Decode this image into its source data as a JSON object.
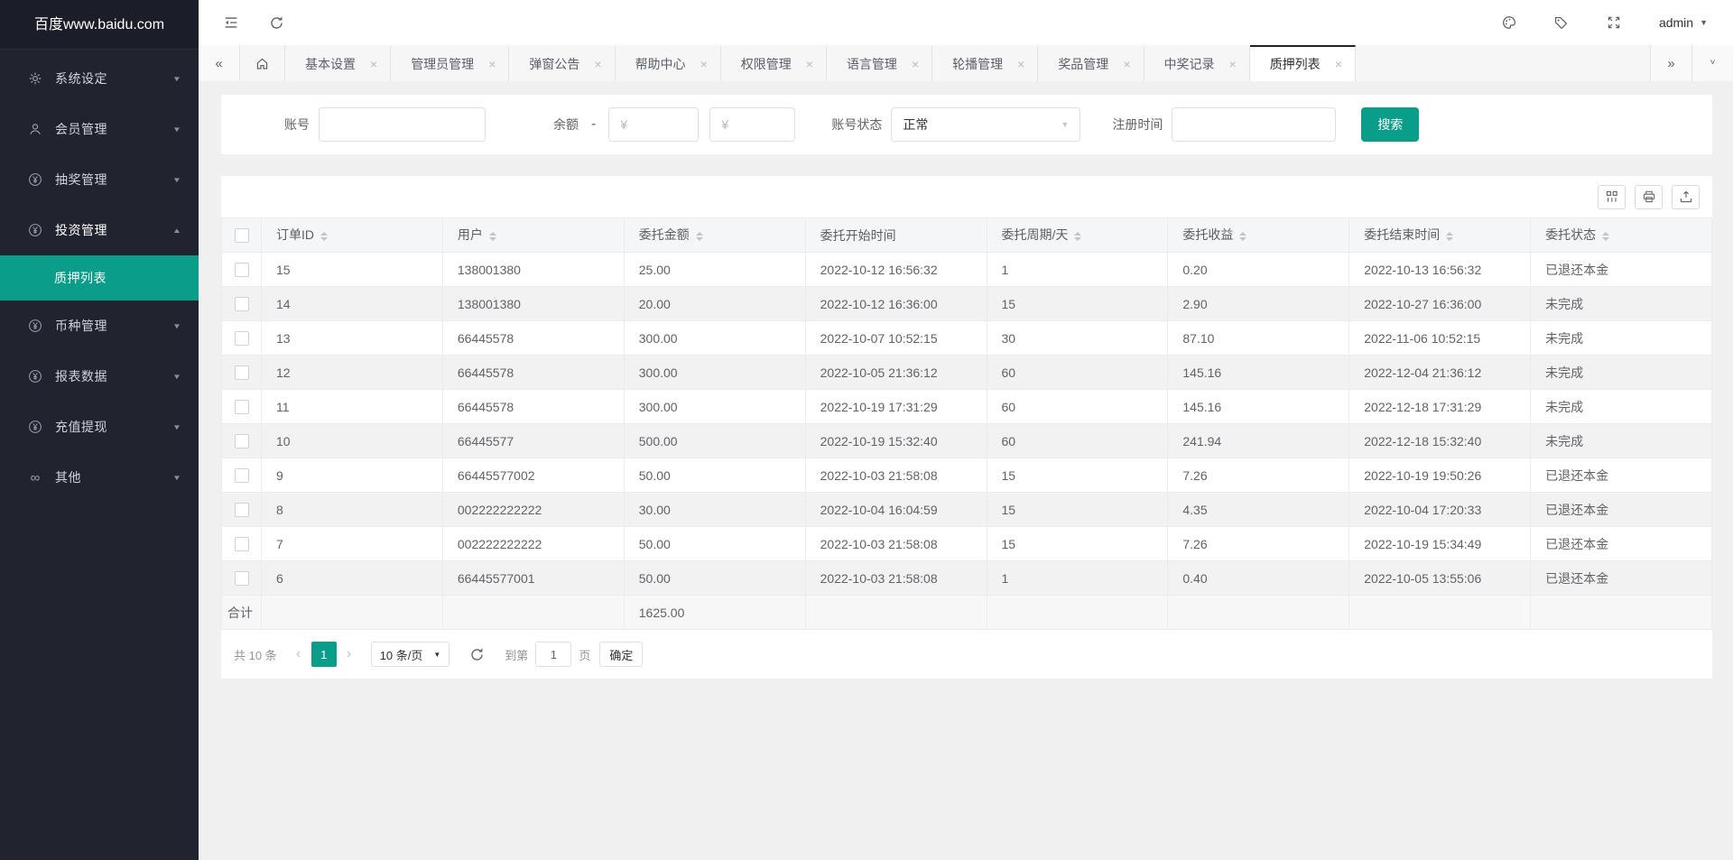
{
  "colors": {
    "accent": "#0a9d8a",
    "sidebar_bg": "#21242e",
    "sidebar_title_bg": "#1b1e28",
    "tab_active_border": "#20232d"
  },
  "sidebar": {
    "title": "百度www.baidu.com",
    "items": [
      {
        "label": "系统设定",
        "icon": "gear-icon",
        "chevron": "down"
      },
      {
        "label": "会员管理",
        "icon": "user-icon",
        "chevron": "down"
      },
      {
        "label": "抽奖管理",
        "icon": "yen-circle-icon",
        "chevron": "down"
      },
      {
        "label": "投资管理",
        "icon": "yen-circle-icon",
        "chevron": "up",
        "expanded": true
      },
      {
        "label": "质押列表",
        "type": "submenu",
        "active": true
      },
      {
        "label": "币种管理",
        "icon": "yen-circle-icon",
        "chevron": "down"
      },
      {
        "label": "报表数据",
        "icon": "yen-circle-icon",
        "chevron": "down"
      },
      {
        "label": "充值提现",
        "icon": "yen-circle-icon",
        "chevron": "down"
      },
      {
        "label": "其他",
        "icon": "infinity-icon",
        "chevron": "down"
      }
    ]
  },
  "topbar": {
    "admin_label": "admin"
  },
  "tabbar": {
    "tabs": [
      {
        "label": "基本设置"
      },
      {
        "label": "管理员管理"
      },
      {
        "label": "弹窗公告"
      },
      {
        "label": "帮助中心"
      },
      {
        "label": "权限管理"
      },
      {
        "label": "语言管理"
      },
      {
        "label": "轮播管理"
      },
      {
        "label": "奖品管理"
      },
      {
        "label": "中奖记录"
      },
      {
        "label": "质押列表",
        "active": true
      }
    ]
  },
  "filters": {
    "account_label": "账号",
    "balance_label": "余额",
    "balance_separator": "-",
    "balance_min_placeholder": "¥",
    "balance_max_placeholder": "¥",
    "status_label": "账号状态",
    "status_value": "正常",
    "register_label": "注册时间",
    "search_button": "搜索"
  },
  "table": {
    "columns": [
      {
        "label": "订单ID",
        "sortable": true
      },
      {
        "label": "用户",
        "sortable": true
      },
      {
        "label": "委托金额",
        "sortable": true
      },
      {
        "label": "委托开始时间",
        "sortable": false
      },
      {
        "label": "委托周期/天",
        "sortable": true
      },
      {
        "label": "委托收益",
        "sortable": true
      },
      {
        "label": "委托结束时间",
        "sortable": true
      },
      {
        "label": "委托状态",
        "sortable": true
      }
    ],
    "rows": [
      [
        "15",
        "138001380",
        "25.00",
        "2022-10-12 16:56:32",
        "1",
        "0.20",
        "2022-10-13 16:56:32",
        "已退还本金"
      ],
      [
        "14",
        "138001380",
        "20.00",
        "2022-10-12 16:36:00",
        "15",
        "2.90",
        "2022-10-27 16:36:00",
        "未完成"
      ],
      [
        "13",
        "66445578",
        "300.00",
        "2022-10-07 10:52:15",
        "30",
        "87.10",
        "2022-11-06 10:52:15",
        "未完成"
      ],
      [
        "12",
        "66445578",
        "300.00",
        "2022-10-05 21:36:12",
        "60",
        "145.16",
        "2022-12-04 21:36:12",
        "未完成"
      ],
      [
        "11",
        "66445578",
        "300.00",
        "2022-10-19 17:31:29",
        "60",
        "145.16",
        "2022-12-18 17:31:29",
        "未完成"
      ],
      [
        "10",
        "66445577",
        "500.00",
        "2022-10-19 15:32:40",
        "60",
        "241.94",
        "2022-12-18 15:32:40",
        "未完成"
      ],
      [
        "9",
        "66445577002",
        "50.00",
        "2022-10-03 21:58:08",
        "15",
        "7.26",
        "2022-10-19 19:50:26",
        "已退还本金"
      ],
      [
        "8",
        "002222222222",
        "30.00",
        "2022-10-04 16:04:59",
        "15",
        "4.35",
        "2022-10-04 17:20:33",
        "已退还本金"
      ],
      [
        "7",
        "002222222222",
        "50.00",
        "2022-10-03 21:58:08",
        "15",
        "7.26",
        "2022-10-19 15:34:49",
        "已退还本金"
      ],
      [
        "6",
        "66445577001",
        "50.00",
        "2022-10-03 21:58:08",
        "1",
        "0.40",
        "2022-10-05 13:55:06",
        "已退还本金"
      ]
    ],
    "summary": {
      "label": "合计",
      "amount": "1625.00",
      "amount_column": "委托金额"
    }
  },
  "pagination": {
    "total_text": "共 10 条",
    "current_page": "1",
    "page_size_label": "10 条/页",
    "goto_label": "到第",
    "goto_value": "1",
    "goto_unit": "页",
    "confirm_label": "确定"
  }
}
